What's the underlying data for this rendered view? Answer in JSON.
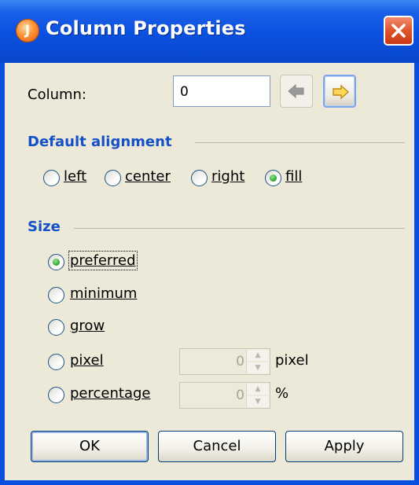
{
  "window": {
    "title": "Column Properties",
    "app_icon_glyph": "J",
    "icons": {
      "app": "app-logo-icon",
      "close": "close-icon"
    }
  },
  "column": {
    "label": "Column:",
    "value": "0",
    "prev_icon": "arrow-left-icon",
    "next_icon": "arrow-right-icon"
  },
  "alignment": {
    "title": "Default alignment",
    "options": [
      "left",
      "center",
      "right",
      "fill"
    ],
    "selected": "fill"
  },
  "size": {
    "title": "Size",
    "options": [
      "preferred",
      "minimum",
      "grow",
      "pixel",
      "percentage"
    ],
    "selected": "preferred",
    "pixel_value": "0",
    "pixel_unit": "pixel",
    "percent_value": "0",
    "percent_unit": "%"
  },
  "buttons": {
    "ok": "OK",
    "cancel": "Cancel",
    "apply": "Apply"
  },
  "colors": {
    "title_bar": "#0a50e0",
    "section_heading": "#1450c8",
    "dialog_bg": "#ece9d8"
  }
}
